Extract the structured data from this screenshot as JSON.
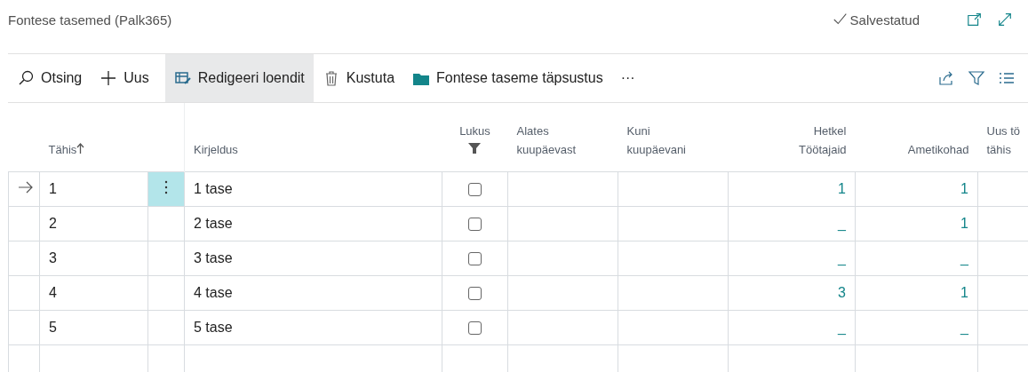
{
  "page": {
    "title": "Fontese tasemed (Palk365)",
    "save_status": "Salvestatud"
  },
  "toolbar": {
    "actions": [
      {
        "kind": "search",
        "label": "Otsing",
        "selected": false
      },
      {
        "kind": "new",
        "label": "Uus",
        "selected": false
      },
      {
        "kind": "edit",
        "label": "Redigeeri loendit",
        "selected": true
      },
      {
        "kind": "delete",
        "label": "Kustuta",
        "selected": false
      },
      {
        "kind": "folder",
        "label": "Fontese taseme täpsustus",
        "selected": false
      },
      {
        "kind": "more",
        "label": "···",
        "selected": false
      }
    ]
  },
  "table": {
    "columns": [
      {
        "kind": "text",
        "lines": [
          "Tähis"
        ],
        "sorted": true,
        "filtered": false
      },
      {
        "kind": "text",
        "lines": [
          "Kirjeldus"
        ],
        "sorted": false,
        "filtered": false
      },
      {
        "kind": "check",
        "lines": [
          "Lukus"
        ],
        "sorted": false,
        "filtered": true
      },
      {
        "kind": "text",
        "lines": [
          "Alates",
          "kuupäevast"
        ],
        "sorted": false,
        "filtered": false
      },
      {
        "kind": "text",
        "lines": [
          "Kuni",
          "kuupäevani"
        ],
        "sorted": false,
        "filtered": false
      },
      {
        "kind": "number",
        "lines": [
          "Hetkel",
          "Töötajaid"
        ],
        "sorted": false,
        "filtered": false
      },
      {
        "kind": "number",
        "lines": [
          "Ametikohad"
        ],
        "sorted": false,
        "filtered": false
      },
      {
        "kind": "text",
        "lines": [
          "Uus tö",
          "tähis"
        ],
        "sorted": false,
        "filtered": false
      }
    ],
    "rows": [
      {
        "current": true,
        "code": "1",
        "description": "1 tase",
        "locked": false,
        "employees": "1",
        "positions": "1"
      },
      {
        "current": false,
        "code": "2",
        "description": "2 tase",
        "locked": false,
        "employees": "_",
        "positions": "1"
      },
      {
        "current": false,
        "code": "3",
        "description": "3 tase",
        "locked": false,
        "employees": "_",
        "positions": "_"
      },
      {
        "current": false,
        "code": "4",
        "description": "4 tase",
        "locked": false,
        "employees": "3",
        "positions": "1"
      },
      {
        "current": false,
        "code": "5",
        "description": "5 tase",
        "locked": false,
        "employees": "_",
        "positions": "_"
      }
    ]
  }
}
